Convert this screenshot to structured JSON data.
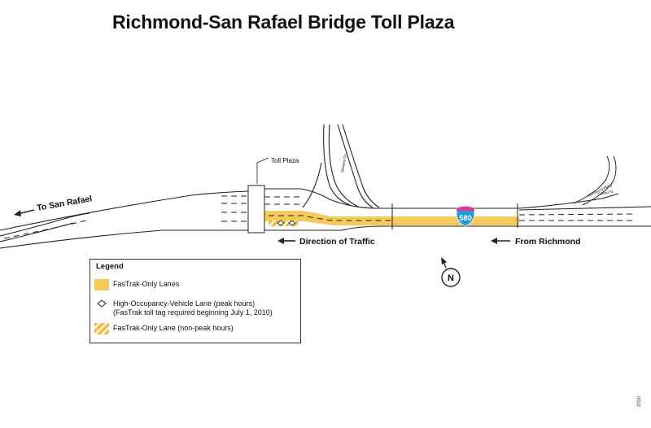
{
  "title": "Richmond-San Rafael Bridge Toll Plaza",
  "labels": {
    "toll_plaza": "Toll Plaza",
    "to_san_rafael": "To San Rafael",
    "direction_of_traffic": "Direction of Traffic",
    "from_richmond": "From Richmond",
    "highway_shield": "580",
    "north": "N",
    "street_1": "Western Dr",
    "street_2": "Richmond Pkwy",
    "street_3": "Castro St"
  },
  "legend": {
    "title": "Legend",
    "items": [
      {
        "label": "FasTrak-Only Lanes",
        "sublabel": ""
      },
      {
        "label": "High-Occupancy-Vehicle Lane (peak hours)",
        "sublabel": "(FasTrak toll tag required beginning July 1, 2010)"
      },
      {
        "label": "FasTrak-Only Lane (non-peak hours)",
        "sublabel": ""
      }
    ]
  },
  "year": "2010",
  "colors": {
    "fastrak": "#f5c95a",
    "fastrak_stripe": "#f0b43c",
    "shield_blue": "#1e9bd7",
    "shield_red": "#e0388c",
    "line": "#222222"
  }
}
